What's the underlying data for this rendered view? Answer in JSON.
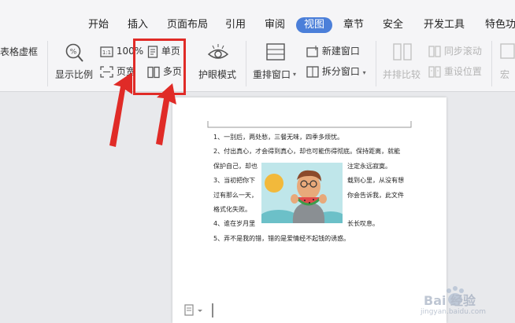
{
  "tabs": [
    {
      "label": "开始"
    },
    {
      "label": "插入"
    },
    {
      "label": "页面布局"
    },
    {
      "label": "引用"
    },
    {
      "label": "审阅"
    },
    {
      "label": "视图"
    },
    {
      "label": "章节"
    },
    {
      "label": "安全"
    },
    {
      "label": "开发工具"
    },
    {
      "label": "特色功能"
    }
  ],
  "ribbon": {
    "table_gridlines": "表格虚框",
    "zoom_ratio": "显示比例",
    "zoom_100": "100%",
    "page_width": "页宽",
    "single_page": "单页",
    "multi_page": "多页",
    "eye_protection": "护眼模式",
    "rearrange_window": "重排窗口",
    "new_window": "新建窗口",
    "split_window": "拆分窗口",
    "side_by_side": "并排比较",
    "sync_scroll": "同步滚动",
    "reset_position": "重设位置",
    "macro": "宏"
  },
  "document": {
    "lines": [
      "1、一别后，两处愁，三餐无味，四季多烦忧。",
      "2、付出真心，才会得到真心，却也可能伤得彻底。保持距离，就能",
      "保护自己，却也",
      "注定永远寂寞。",
      "3、当初把你下",
      "载到心里，从没有想",
      "过有那么一天，",
      "你会告诉我，此文件",
      "格式化失败。",
      "4、谁在岁月里",
      "长长叹息。",
      "5、弄不是我的错，错的是爱情经不起钱的诱惑。"
    ]
  },
  "watermark_text": "Bai 经验",
  "watermark_url": "jingyan.baidu.com",
  "colors": {
    "accent": "#4b7fd9",
    "highlight": "#e02b27"
  }
}
